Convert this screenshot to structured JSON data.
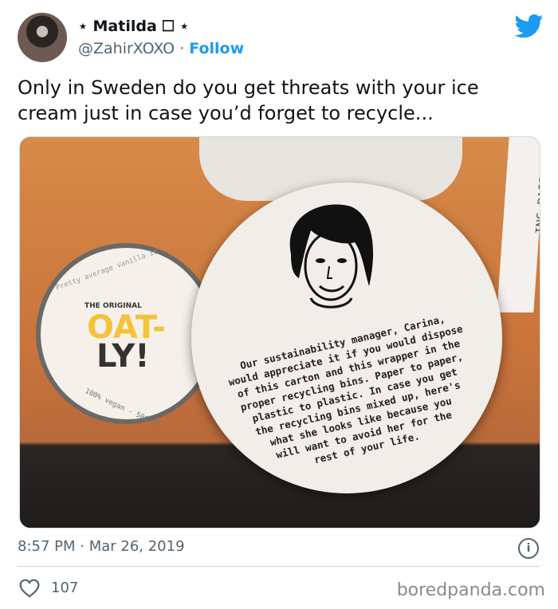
{
  "author": {
    "display_name": "⋆ Matilda 🞎 ⋆",
    "handle": "@ZahirXOXO",
    "separator": "·",
    "follow_label": "Follow"
  },
  "tweet": {
    "text": "Only in Sweden do you get threats with your ice cream just in case you’d forget to recycle..."
  },
  "media": {
    "ticket_text": "ING PASS:",
    "small_lid": {
      "ring_text": "Pretty average vanilla ic",
      "brand": "THE ORIGINAL",
      "logo_top": "OAT-",
      "logo_bottom": "LY!",
      "footer": "100% vegan - 500 ml"
    },
    "big_lid_text": "Our sustainability manager, Carina,\nwould appreciate it if you would dispose\nof this carton and this wrapper in the\nproper recycling bins. Paper to paper,\nplastic to plastic. In case you get\nthe recycling bins mixed up, here's\nwhat she looks like because you\nwill want to avoid her for the\nrest of your life."
  },
  "meta": {
    "timestamp": "8:57 PM · Mar 26, 2019",
    "like_count": "107",
    "watermark": "boredpanda.com"
  },
  "colors": {
    "accent": "#1d9bf0",
    "muted": "#536471"
  },
  "icons": {
    "bird": "twitter-bird-icon",
    "info": "info-icon",
    "heart": "heart-icon"
  }
}
